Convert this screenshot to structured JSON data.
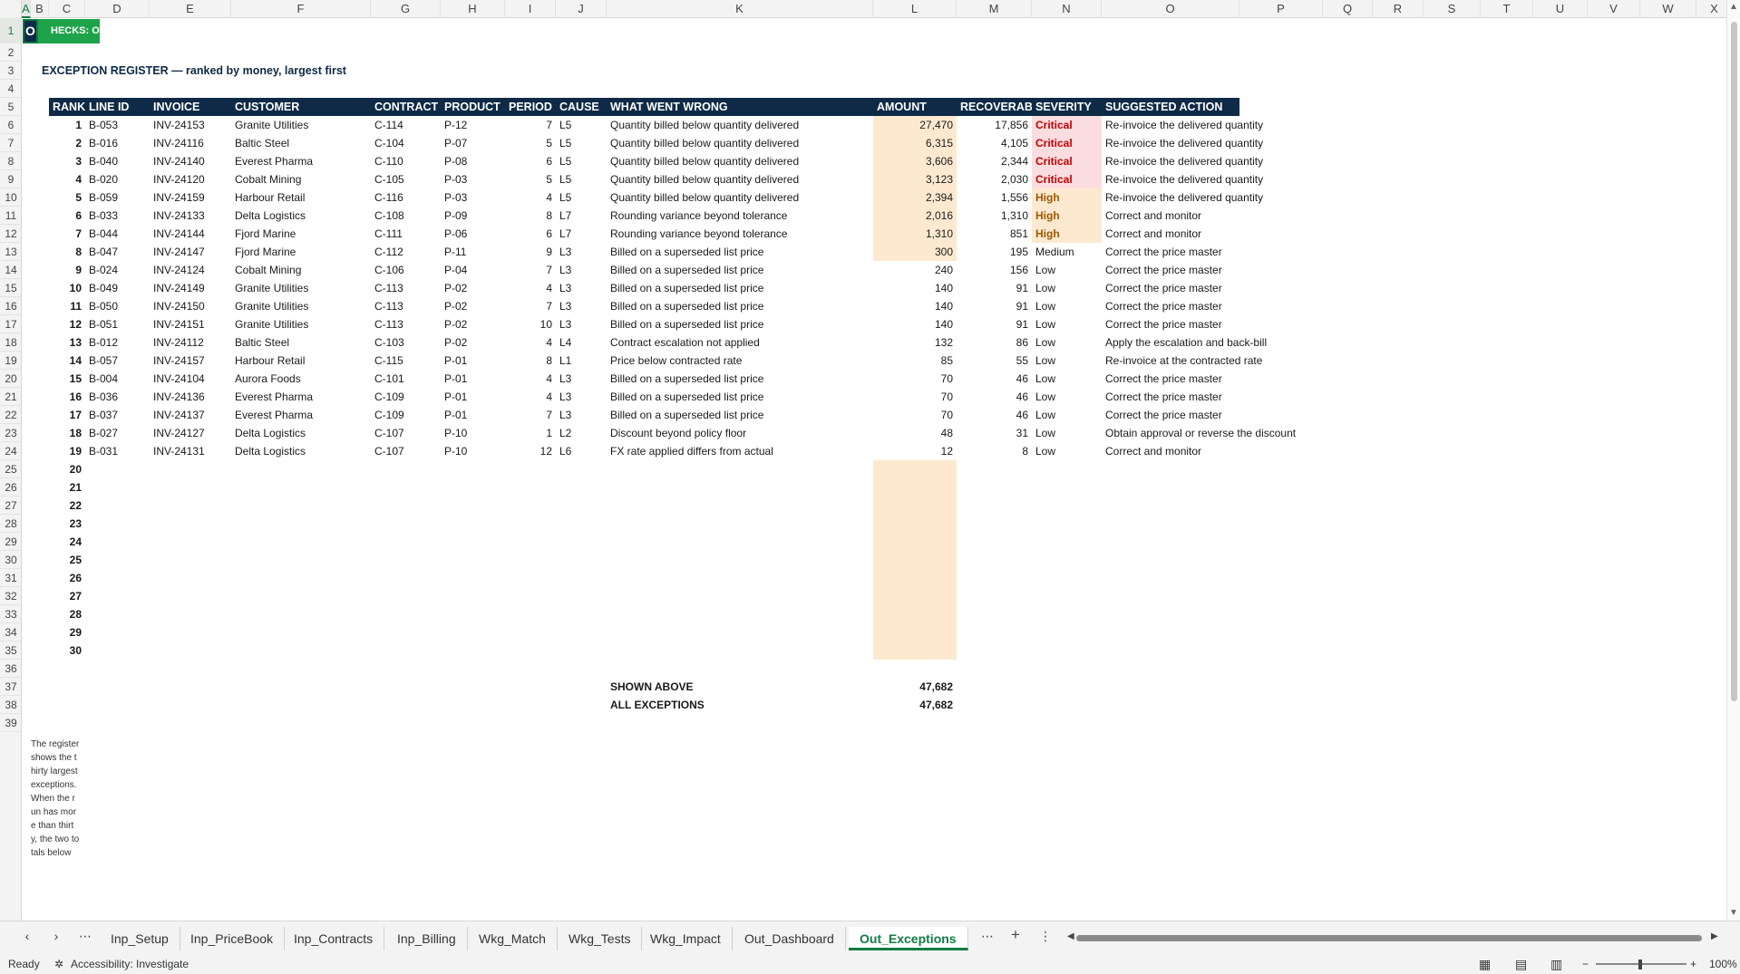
{
  "columns": [
    "A",
    "B",
    "C",
    "D",
    "E",
    "F",
    "G",
    "H",
    "I",
    "J",
    "K",
    "L",
    "M",
    "N",
    "O",
    "P",
    "Q",
    "R",
    "S",
    "T",
    "U",
    "V",
    "W",
    "X"
  ],
  "selected_column": "A",
  "selected_row": "1",
  "rows_visible": [
    "1",
    "2",
    "3",
    "4",
    "5",
    "6",
    "7",
    "8",
    "9",
    "10",
    "11",
    "12",
    "13",
    "14",
    "15",
    "16",
    "17",
    "18",
    "19",
    "20",
    "21",
    "22",
    "23",
    "24",
    "25",
    "26",
    "27",
    "28",
    "29",
    "30",
    "31",
    "32",
    "33",
    "34",
    "35",
    "36",
    "37",
    "38",
    "39"
  ],
  "active_cell_text": "O",
  "checks_banner": "HECKS: OK",
  "register_title": "EXCEPTION REGISTER — ranked by money, largest first",
  "headers": {
    "rank": "RANK",
    "line_id": "LINE ID",
    "invoice": "INVOICE",
    "customer": "CUSTOMER",
    "contract": "CONTRACT",
    "product": "PRODUCT",
    "period": "PERIOD",
    "cause": "CAUSE",
    "what": "WHAT WENT WRONG",
    "amount": "AMOUNT",
    "recoverable": "RECOVERAB",
    "severity": "SEVERITY",
    "action": "SUGGESTED ACTION"
  },
  "exceptions": [
    {
      "rank": "1",
      "line_id": "B-053",
      "invoice": "INV-24153",
      "customer": "Granite Utilities",
      "contract": "C-114",
      "product": "P-12",
      "period": "7",
      "cause": "L5",
      "what": "Quantity billed below quantity delivered",
      "amount": "27,470",
      "recoverable": "17,856",
      "severity": "Critical",
      "action": "Re-invoice the delivered quantity"
    },
    {
      "rank": "2",
      "line_id": "B-016",
      "invoice": "INV-24116",
      "customer": "Baltic Steel",
      "contract": "C-104",
      "product": "P-07",
      "period": "5",
      "cause": "L5",
      "what": "Quantity billed below quantity delivered",
      "amount": "6,315",
      "recoverable": "4,105",
      "severity": "Critical",
      "action": "Re-invoice the delivered quantity"
    },
    {
      "rank": "3",
      "line_id": "B-040",
      "invoice": "INV-24140",
      "customer": "Everest Pharma",
      "contract": "C-110",
      "product": "P-08",
      "period": "6",
      "cause": "L5",
      "what": "Quantity billed below quantity delivered",
      "amount": "3,606",
      "recoverable": "2,344",
      "severity": "Critical",
      "action": "Re-invoice the delivered quantity"
    },
    {
      "rank": "4",
      "line_id": "B-020",
      "invoice": "INV-24120",
      "customer": "Cobalt Mining",
      "contract": "C-105",
      "product": "P-03",
      "period": "5",
      "cause": "L5",
      "what": "Quantity billed below quantity delivered",
      "amount": "3,123",
      "recoverable": "2,030",
      "severity": "Critical",
      "action": "Re-invoice the delivered quantity"
    },
    {
      "rank": "5",
      "line_id": "B-059",
      "invoice": "INV-24159",
      "customer": "Harbour Retail",
      "contract": "C-116",
      "product": "P-03",
      "period": "4",
      "cause": "L5",
      "what": "Quantity billed below quantity delivered",
      "amount": "2,394",
      "recoverable": "1,556",
      "severity": "High",
      "action": "Re-invoice the delivered quantity"
    },
    {
      "rank": "6",
      "line_id": "B-033",
      "invoice": "INV-24133",
      "customer": "Delta Logistics",
      "contract": "C-108",
      "product": "P-09",
      "period": "8",
      "cause": "L7",
      "what": "Rounding variance beyond tolerance",
      "amount": "2,016",
      "recoverable": "1,310",
      "severity": "High",
      "action": "Correct and monitor"
    },
    {
      "rank": "7",
      "line_id": "B-044",
      "invoice": "INV-24144",
      "customer": "Fjord Marine",
      "contract": "C-111",
      "product": "P-06",
      "period": "6",
      "cause": "L7",
      "what": "Rounding variance beyond tolerance",
      "amount": "1,310",
      "recoverable": "851",
      "severity": "High",
      "action": "Correct and monitor"
    },
    {
      "rank": "8",
      "line_id": "B-047",
      "invoice": "INV-24147",
      "customer": "Fjord Marine",
      "contract": "C-112",
      "product": "P-11",
      "period": "9",
      "cause": "L3",
      "what": "Billed on a superseded list price",
      "amount": "300",
      "recoverable": "195",
      "severity": "Medium",
      "action": "Correct the price master"
    },
    {
      "rank": "9",
      "line_id": "B-024",
      "invoice": "INV-24124",
      "customer": "Cobalt Mining",
      "contract": "C-106",
      "product": "P-04",
      "period": "7",
      "cause": "L3",
      "what": "Billed on a superseded list price",
      "amount": "240",
      "recoverable": "156",
      "severity": "Low",
      "action": "Correct the price master"
    },
    {
      "rank": "10",
      "line_id": "B-049",
      "invoice": "INV-24149",
      "customer": "Granite Utilities",
      "contract": "C-113",
      "product": "P-02",
      "period": "4",
      "cause": "L3",
      "what": "Billed on a superseded list price",
      "amount": "140",
      "recoverable": "91",
      "severity": "Low",
      "action": "Correct the price master"
    },
    {
      "rank": "11",
      "line_id": "B-050",
      "invoice": "INV-24150",
      "customer": "Granite Utilities",
      "contract": "C-113",
      "product": "P-02",
      "period": "7",
      "cause": "L3",
      "what": "Billed on a superseded list price",
      "amount": "140",
      "recoverable": "91",
      "severity": "Low",
      "action": "Correct the price master"
    },
    {
      "rank": "12",
      "line_id": "B-051",
      "invoice": "INV-24151",
      "customer": "Granite Utilities",
      "contract": "C-113",
      "product": "P-02",
      "period": "10",
      "cause": "L3",
      "what": "Billed on a superseded list price",
      "amount": "140",
      "recoverable": "91",
      "severity": "Low",
      "action": "Correct the price master"
    },
    {
      "rank": "13",
      "line_id": "B-012",
      "invoice": "INV-24112",
      "customer": "Baltic Steel",
      "contract": "C-103",
      "product": "P-02",
      "period": "4",
      "cause": "L4",
      "what": "Contract escalation not applied",
      "amount": "132",
      "recoverable": "86",
      "severity": "Low",
      "action": "Apply the escalation and back-bill"
    },
    {
      "rank": "14",
      "line_id": "B-057",
      "invoice": "INV-24157",
      "customer": "Harbour Retail",
      "contract": "C-115",
      "product": "P-01",
      "period": "8",
      "cause": "L1",
      "what": "Price below contracted rate",
      "amount": "85",
      "recoverable": "55",
      "severity": "Low",
      "action": "Re-invoice at the contracted rate"
    },
    {
      "rank": "15",
      "line_id": "B-004",
      "invoice": "INV-24104",
      "customer": "Aurora Foods",
      "contract": "C-101",
      "product": "P-01",
      "period": "4",
      "cause": "L3",
      "what": "Billed on a superseded list price",
      "amount": "70",
      "recoverable": "46",
      "severity": "Low",
      "action": "Correct the price master"
    },
    {
      "rank": "16",
      "line_id": "B-036",
      "invoice": "INV-24136",
      "customer": "Everest Pharma",
      "contract": "C-109",
      "product": "P-01",
      "period": "4",
      "cause": "L3",
      "what": "Billed on a superseded list price",
      "amount": "70",
      "recoverable": "46",
      "severity": "Low",
      "action": "Correct the price master"
    },
    {
      "rank": "17",
      "line_id": "B-037",
      "invoice": "INV-24137",
      "customer": "Everest Pharma",
      "contract": "C-109",
      "product": "P-01",
      "period": "7",
      "cause": "L3",
      "what": "Billed on a superseded list price",
      "amount": "70",
      "recoverable": "46",
      "severity": "Low",
      "action": "Correct the price master"
    },
    {
      "rank": "18",
      "line_id": "B-027",
      "invoice": "INV-24127",
      "customer": "Delta Logistics",
      "contract": "C-107",
      "product": "P-10",
      "period": "1",
      "cause": "L2",
      "what": "Discount beyond policy floor",
      "amount": "48",
      "recoverable": "31",
      "severity": "Low",
      "action": "Obtain approval or reverse the discount"
    },
    {
      "rank": "19",
      "line_id": "B-031",
      "invoice": "INV-24131",
      "customer": "Delta Logistics",
      "contract": "C-107",
      "product": "P-10",
      "period": "12",
      "cause": "L6",
      "what": "FX rate applied differs from actual",
      "amount": "12",
      "recoverable": "8",
      "severity": "Low",
      "action": "Correct and monitor"
    }
  ],
  "empty_ranks": [
    "20",
    "21",
    "22",
    "23",
    "24",
    "25",
    "26",
    "27",
    "28",
    "29",
    "30"
  ],
  "totals": [
    {
      "label": "SHOWN ABOVE",
      "value": "47,682"
    },
    {
      "label": "ALL EXCEPTIONS",
      "value": "47,682"
    }
  ],
  "note_text": "The register shows the thirty largest exceptions. When the run has more than thirty, the two totals below",
  "sheet_tabs": [
    "Inp_Setup",
    "Inp_PriceBook",
    "Inp_Contracts",
    "Inp_Billing",
    "Wkg_Match",
    "Wkg_Tests",
    "Wkg_Impact",
    "Out_Dashboard",
    "Out_Exceptions"
  ],
  "active_tab": "Out_Exceptions",
  "status": {
    "ready": "Ready",
    "accessibility": "Accessibility: Investigate",
    "zoom": "100%"
  },
  "colors": {
    "header_bg": "#0e2a47",
    "amount_fill": "#fde9cf",
    "critical": "#c00000",
    "high": "#9c5700",
    "accent": "#107c41",
    "banner": "#1fa34a"
  }
}
